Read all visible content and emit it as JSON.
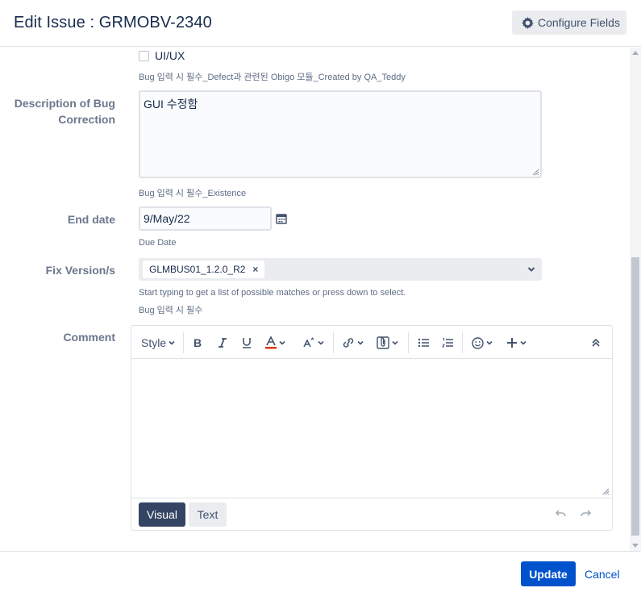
{
  "header": {
    "title": "Edit Issue : GRMOBV-2340",
    "configure_label": "Configure Fields"
  },
  "fields": {
    "uiux_label": "UI/UX",
    "uiux_desc": "Bug 입력 시 필수_Defect과 관련된 Obigo 모듈_Created by QA_Teddy",
    "bug_correction": {
      "label_line1": "Description of Bug",
      "label_line2": "Correction",
      "value": "GUI 수정함",
      "desc": "Bug 입력 시 필수_Existence"
    },
    "end_date": {
      "label": "End date",
      "value": "9/May/22",
      "desc": "Due Date"
    },
    "fix_version": {
      "label": "Fix Version/s",
      "tag": "GLMBUS01_1.2.0_R2",
      "tag_remove": "×",
      "desc1": "Start typing to get a list of possible matches or press down to select.",
      "desc2": "Bug 입력 시 필수"
    },
    "comment": {
      "label": "Comment",
      "toolbar": {
        "style_label": "Style"
      },
      "tab_visual": "Visual",
      "tab_text": "Text"
    }
  },
  "footer": {
    "update_label": "Update",
    "cancel_label": "Cancel"
  },
  "colors": {
    "primary": "#0052cc",
    "dark_tab": "#344563",
    "text": "#172b4d",
    "label": "#6b778c",
    "font_color_icon": "#de350b"
  },
  "icons": [
    "gear-icon",
    "calendar-icon",
    "chevron-down-icon",
    "bold-icon",
    "italic-icon",
    "underline-icon",
    "text-color-icon",
    "format-icon",
    "link-icon",
    "attachment-icon",
    "bullet-list-icon",
    "numbered-list-icon",
    "emoji-icon",
    "insert-more-icon",
    "collapse-toolbar-icon",
    "undo-icon",
    "redo-icon"
  ]
}
